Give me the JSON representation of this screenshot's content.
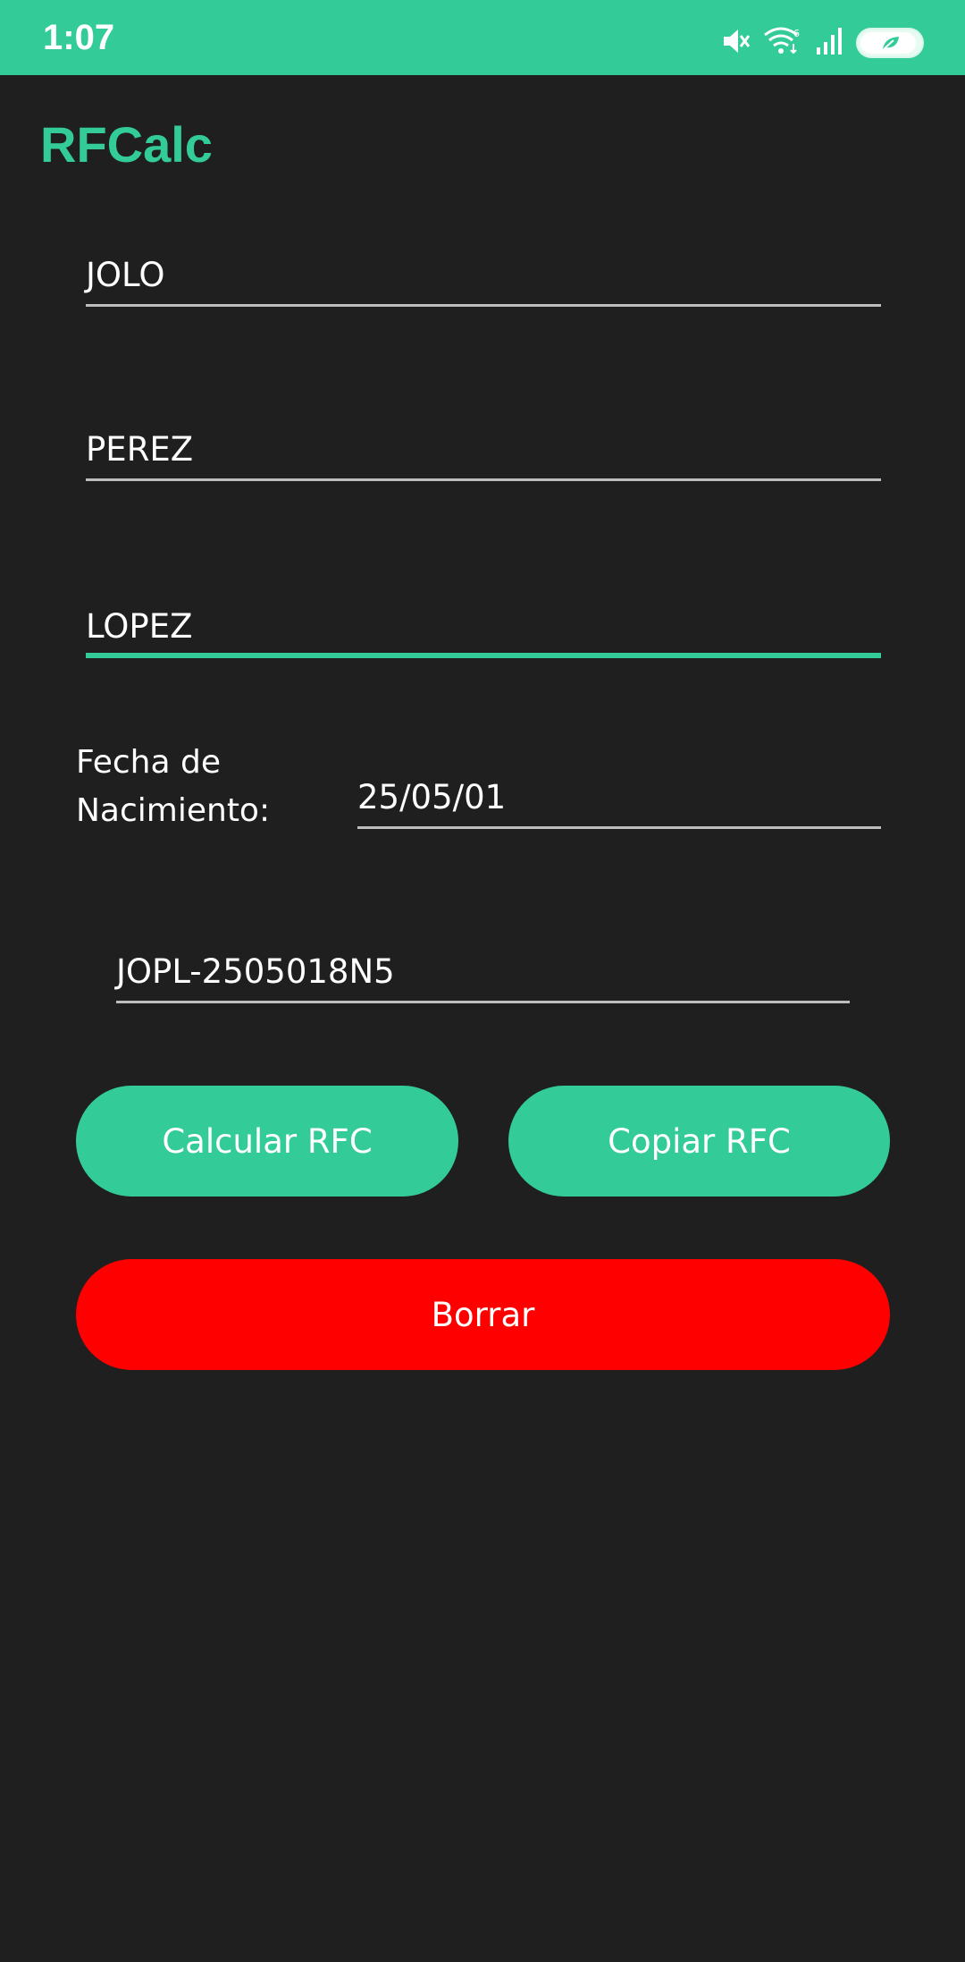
{
  "status_bar": {
    "time": "1:07",
    "icons": [
      "mute-icon",
      "wifi-icon",
      "signal-icon",
      "battery-saver-icon"
    ],
    "color": "#33cb98"
  },
  "app": {
    "title": "RFCalc",
    "accent_color": "#33cb98",
    "background_color": "#1f1f1f"
  },
  "form": {
    "nombre": "JOLO",
    "apellido_paterno": "PEREZ",
    "apellido_materno": "LOPEZ",
    "dob_label_line1": "Fecha de",
    "dob_label_line2": "Nacimiento:",
    "dob_value": "25/05/01",
    "rfc_result": "JOPL-2505018N5"
  },
  "buttons": {
    "calcular": "Calcular RFC",
    "copiar": "Copiar RFC",
    "borrar": "Borrar",
    "borrar_color": "#ff0000"
  }
}
